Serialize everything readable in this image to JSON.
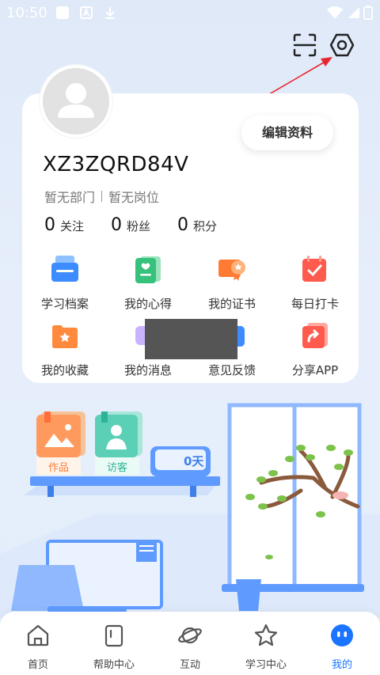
{
  "status_bar": {
    "time": "10:50"
  },
  "profile": {
    "edit_label": "编辑资料",
    "username": "XZ3ZQRD84V",
    "department": "暂无部门",
    "position": "暂无岗位",
    "stats": [
      {
        "num": "0",
        "label": "关注"
      },
      {
        "num": "0",
        "label": "粉丝"
      },
      {
        "num": "0",
        "label": "积分"
      }
    ]
  },
  "grid": [
    {
      "label": "学习档案",
      "icon": "learning-record-icon",
      "color": "#3d8cff"
    },
    {
      "label": "我的心得",
      "icon": "notes-icon",
      "color": "#36c27c"
    },
    {
      "label": "我的证书",
      "icon": "certificate-icon",
      "color": "#ff7a33"
    },
    {
      "label": "每日打卡",
      "icon": "check-in-icon",
      "color": "#ff5a4e"
    },
    {
      "label": "我的收藏",
      "icon": "favorites-icon",
      "color": "#ff8a3d"
    },
    {
      "label": "我的消息",
      "icon": "messages-icon",
      "color": "#b18cff"
    },
    {
      "label": "意见反馈",
      "icon": "feedback-icon",
      "color": "#3d8cff"
    },
    {
      "label": "分享APP",
      "icon": "share-icon",
      "color": "#ff5a4e"
    }
  ],
  "decor": {
    "works_label": "作品",
    "visitors_label": "访客",
    "days_label": "0天"
  },
  "tabs": [
    {
      "label": "首页",
      "icon": "home-icon"
    },
    {
      "label": "帮助中心",
      "icon": "help-book-icon"
    },
    {
      "label": "互动",
      "icon": "planet-icon"
    },
    {
      "label": "学习中心",
      "icon": "star-icon"
    },
    {
      "label": "我的",
      "icon": "profile-face-icon",
      "active": true
    }
  ],
  "colors": {
    "accent": "#1a74ff",
    "background": "#e2ecfa"
  }
}
